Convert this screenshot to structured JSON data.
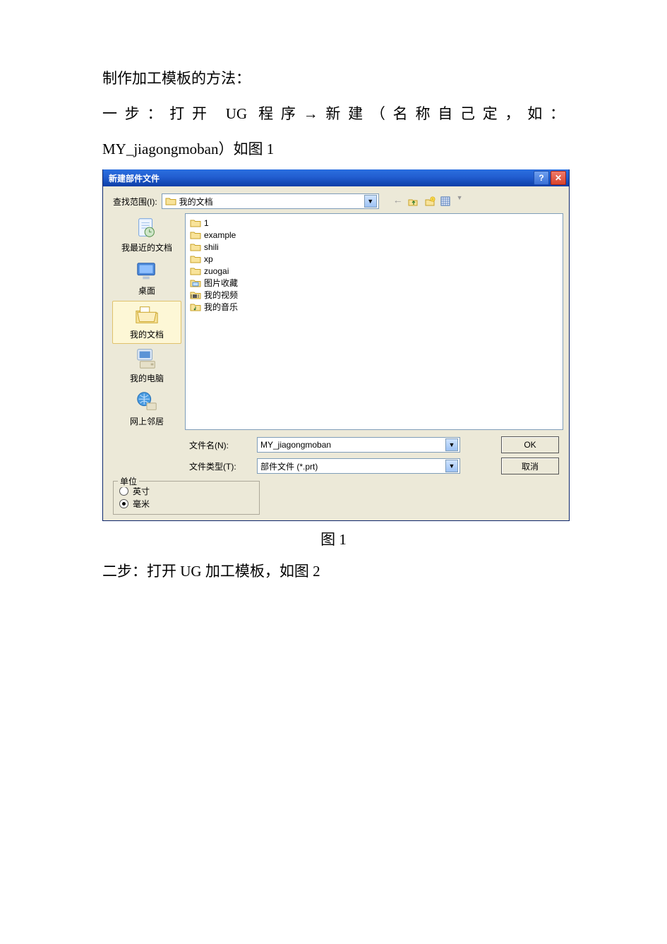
{
  "doc": {
    "heading": "制作加工模板的方法：",
    "step1a": "一步：打开 UG 程序→新建（名称自己定，如：",
    "step1b": "MY_jiagongmoban）如图 1",
    "caption1": "图 1",
    "step2": "二步：打开 UG 加工模板，如图 2"
  },
  "dialog": {
    "title": "新建部件文件",
    "lookin_label": "查找范围(I):",
    "lookin_value": "我的文档",
    "places": {
      "recent": "我最近的文档",
      "desktop": "桌面",
      "mydocs": "我的文档",
      "mycomp": "我的电脑",
      "network": "网上邻居"
    },
    "files": [
      {
        "icon": "folder",
        "name": "1"
      },
      {
        "icon": "folder",
        "name": "example"
      },
      {
        "icon": "folder",
        "name": "shili"
      },
      {
        "icon": "folder",
        "name": "xp"
      },
      {
        "icon": "folder",
        "name": "zuogai"
      },
      {
        "icon": "picfolder",
        "name": "图片收藏"
      },
      {
        "icon": "vidfolder",
        "name": "我的视频"
      },
      {
        "icon": "musfolder",
        "name": "我的音乐"
      }
    ],
    "filename_label": "文件名(N):",
    "filename_value": "MY_jiagongmoban",
    "filetype_label": "文件类型(T):",
    "filetype_value": "部件文件 (*.prt)",
    "ok": "OK",
    "cancel": "取消",
    "units_legend": "单位",
    "unit_inch": "英寸",
    "unit_mm": "毫米"
  }
}
